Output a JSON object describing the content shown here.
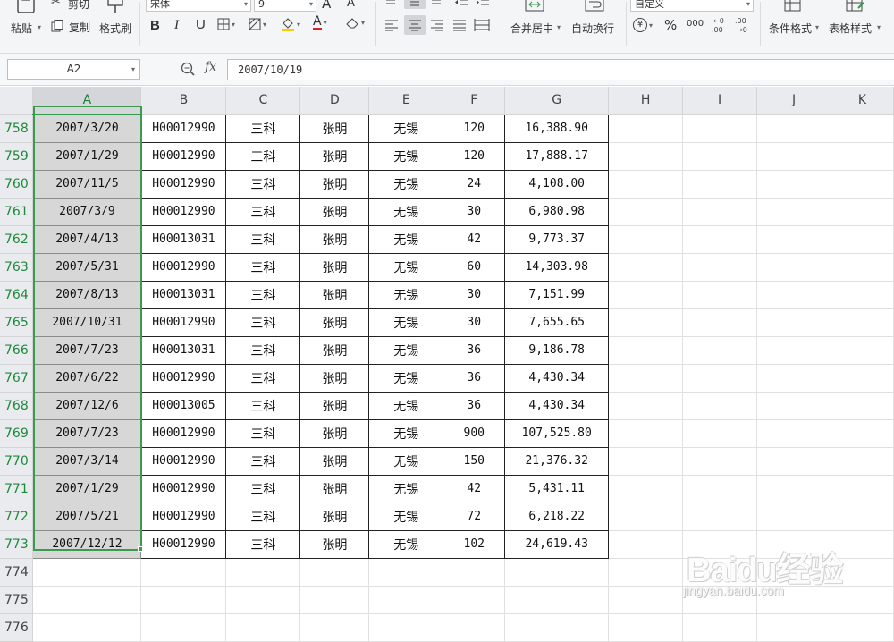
{
  "ribbon": {
    "paste_label": "粘贴",
    "cut_label": "剪切",
    "copy_label": "复制",
    "format_painter_label": "格式刷",
    "font_name": "宋体",
    "font_size": "9",
    "grow_font": "A",
    "shrink_font": "A",
    "bold": "B",
    "italic": "I",
    "underline": "U",
    "font_color_glyph": "A",
    "merge_center_label": "合并居中",
    "wrap_text_label": "自动换行",
    "number_format": "自定义",
    "currency_glyph": "¥",
    "percent_glyph": "%",
    "thousands_glyph": "000",
    "conditional_format_label": "条件格式",
    "table_style_label": "表格样式"
  },
  "formula_bar": {
    "name_box": "A2",
    "fx_label": "fx",
    "formula": "2007/10/19"
  },
  "sheet": {
    "columns": [
      "A",
      "B",
      "C",
      "D",
      "E",
      "F",
      "G",
      "H",
      "I",
      "J",
      "K"
    ],
    "selected_column": "A",
    "rows": [
      {
        "num": "758",
        "a": "2007/3/20",
        "b": "H00012990",
        "c": "三科",
        "d": "张明",
        "e": "无锡",
        "f": "120",
        "g": "16,388.90"
      },
      {
        "num": "759",
        "a": "2007/1/29",
        "b": "H00012990",
        "c": "三科",
        "d": "张明",
        "e": "无锡",
        "f": "120",
        "g": "17,888.17"
      },
      {
        "num": "760",
        "a": "2007/11/5",
        "b": "H00012990",
        "c": "三科",
        "d": "张明",
        "e": "无锡",
        "f": "24",
        "g": "4,108.00"
      },
      {
        "num": "761",
        "a": "2007/3/9",
        "b": "H00012990",
        "c": "三科",
        "d": "张明",
        "e": "无锡",
        "f": "30",
        "g": "6,980.98"
      },
      {
        "num": "762",
        "a": "2007/4/13",
        "b": "H00013031",
        "c": "三科",
        "d": "张明",
        "e": "无锡",
        "f": "42",
        "g": "9,773.37"
      },
      {
        "num": "763",
        "a": "2007/5/31",
        "b": "H00012990",
        "c": "三科",
        "d": "张明",
        "e": "无锡",
        "f": "60",
        "g": "14,303.98"
      },
      {
        "num": "764",
        "a": "2007/8/13",
        "b": "H00013031",
        "c": "三科",
        "d": "张明",
        "e": "无锡",
        "f": "30",
        "g": "7,151.99"
      },
      {
        "num": "765",
        "a": "2007/10/31",
        "b": "H00012990",
        "c": "三科",
        "d": "张明",
        "e": "无锡",
        "f": "30",
        "g": "7,655.65"
      },
      {
        "num": "766",
        "a": "2007/7/23",
        "b": "H00013031",
        "c": "三科",
        "d": "张明",
        "e": "无锡",
        "f": "36",
        "g": "9,186.78"
      },
      {
        "num": "767",
        "a": "2007/6/22",
        "b": "H00012990",
        "c": "三科",
        "d": "张明",
        "e": "无锡",
        "f": "36",
        "g": "4,430.34"
      },
      {
        "num": "768",
        "a": "2007/12/6",
        "b": "H00013005",
        "c": "三科",
        "d": "张明",
        "e": "无锡",
        "f": "36",
        "g": "4,430.34"
      },
      {
        "num": "769",
        "a": "2007/7/23",
        "b": "H00012990",
        "c": "三科",
        "d": "张明",
        "e": "无锡",
        "f": "900",
        "g": "107,525.80"
      },
      {
        "num": "770",
        "a": "2007/3/14",
        "b": "H00012990",
        "c": "三科",
        "d": "张明",
        "e": "无锡",
        "f": "150",
        "g": "21,376.32"
      },
      {
        "num": "771",
        "a": "2007/1/29",
        "b": "H00012990",
        "c": "三科",
        "d": "张明",
        "e": "无锡",
        "f": "42",
        "g": "5,431.11"
      },
      {
        "num": "772",
        "a": "2007/5/21",
        "b": "H00012990",
        "c": "三科",
        "d": "张明",
        "e": "无锡",
        "f": "72",
        "g": "6,218.22"
      },
      {
        "num": "773",
        "a": "2007/12/12",
        "b": "H00012990",
        "c": "三科",
        "d": "张明",
        "e": "无锡",
        "f": "102",
        "g": "24,619.43"
      }
    ],
    "empty_rows": [
      "774",
      "775",
      "776"
    ]
  },
  "watermark": {
    "brand": "Baidu经验",
    "url": "jingyan.baidu.com"
  },
  "colors": {
    "selection_green": "#3c9a4f",
    "row_header_green": "#1f8a3c",
    "ribbon_bg": "#f4f5f6",
    "header_bg": "#e9ebee"
  }
}
